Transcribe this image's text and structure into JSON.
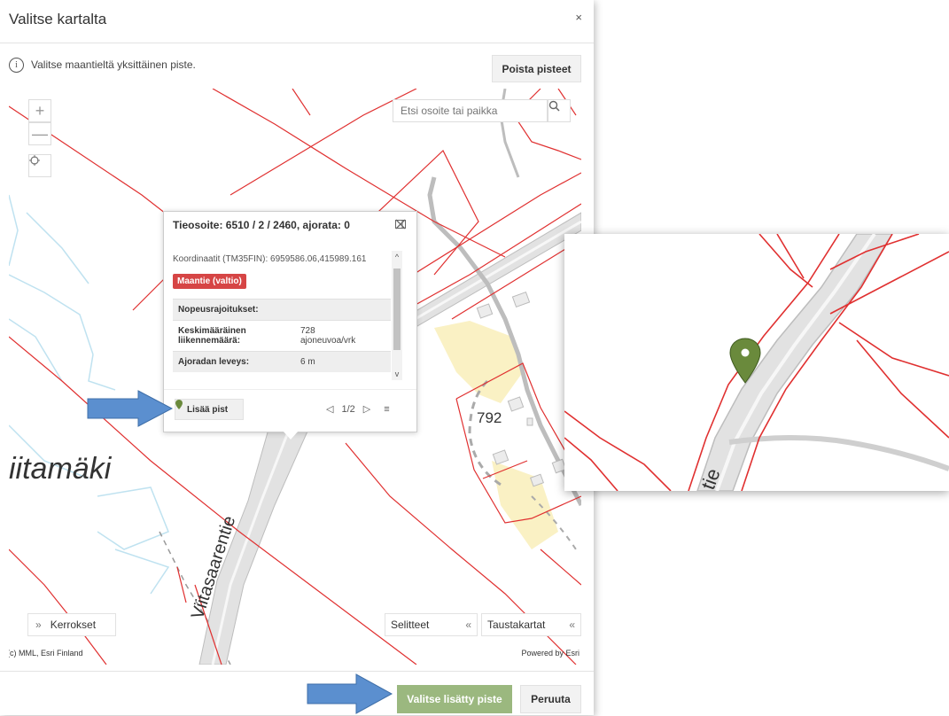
{
  "dialog": {
    "title": "Valitse kartalta",
    "close_symbol": "×",
    "info_text": "Valitse maantieltä yksittäinen piste.",
    "info_icon": "info-circle-icon",
    "clear_points_label": "Poista pisteet",
    "confirm_label": "Valitse lisätty piste",
    "cancel_label": "Peruuta"
  },
  "map": {
    "zoom_in_symbol": "+",
    "zoom_out_symbol": "—",
    "locate_icon": "crosshair-icon",
    "search": {
      "placeholder": "Etsi osoite tai paikka",
      "icon": "search-icon"
    },
    "labels": {
      "place": "iitamäki",
      "road": "Viitasaarentie",
      "house_number": "792"
    },
    "layers_label": "Kerrokset",
    "legend_label": "Selitteet",
    "basemaps_label": "Taustakartat",
    "attribution_left": "(c) MML, Esri Finland",
    "attribution_right": "Powered by Esri"
  },
  "popup": {
    "title": "Tieosoite: 6510 / 2 / 2460, ajorata: 0",
    "coordinates": "Koordinaatit (TM35FIN): 6959586.06,415989.161",
    "badge": "Maantie (valtio)",
    "rows": [
      {
        "key": "Nopeusrajoitukset:",
        "value": ""
      },
      {
        "key": "Keskimääräinen liikennemäärä:",
        "value": "728 ajoneuvoa/vrk"
      },
      {
        "key": "Ajoradan leveys:",
        "value": "6 m"
      }
    ],
    "add_point_label": "Lisää pist",
    "pager": "1/2",
    "icons": [
      "dock-icon",
      "close-icon",
      "menu-icon",
      "pin-icon"
    ]
  },
  "colors": {
    "property_line": "#e03030",
    "road_fill": "#d9d9d9",
    "badge": "#d64545",
    "confirm_button": "#9bb87f",
    "pin": "#6a8a3c",
    "callout_arrow": "#5b8fcf",
    "yellow_area": "#faf1c4",
    "water_line": "#bfe2f0"
  }
}
